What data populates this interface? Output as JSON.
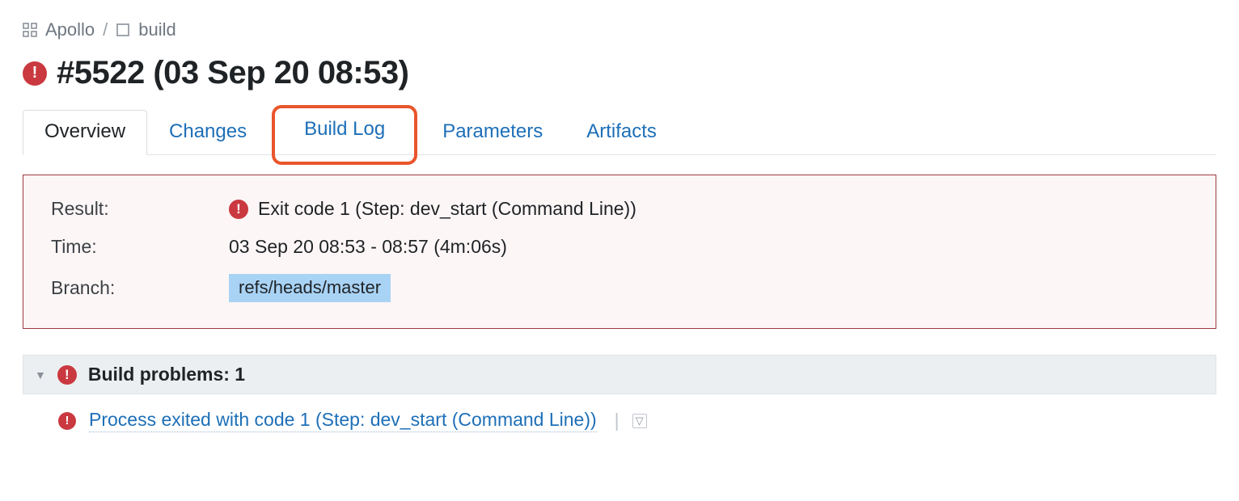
{
  "breadcrumb": {
    "project": "Apollo",
    "config": "build"
  },
  "title": "#5522 (03 Sep 20 08:53)",
  "tabs": {
    "overview": "Overview",
    "changes": "Changes",
    "buildlog": "Build Log",
    "parameters": "Parameters",
    "artifacts": "Artifacts"
  },
  "summary": {
    "result_label": "Result:",
    "result_value": "Exit code 1 (Step: dev_start (Command Line))",
    "time_label": "Time:",
    "time_value": "03 Sep 20 08:53 - 08:57 (4m:06s)",
    "branch_label": "Branch:",
    "branch_value": "refs/heads/master"
  },
  "problems": {
    "header": "Build problems: 1",
    "items": [
      {
        "text": "Process exited with code 1 (Step: dev_start (Command Line))"
      }
    ]
  }
}
